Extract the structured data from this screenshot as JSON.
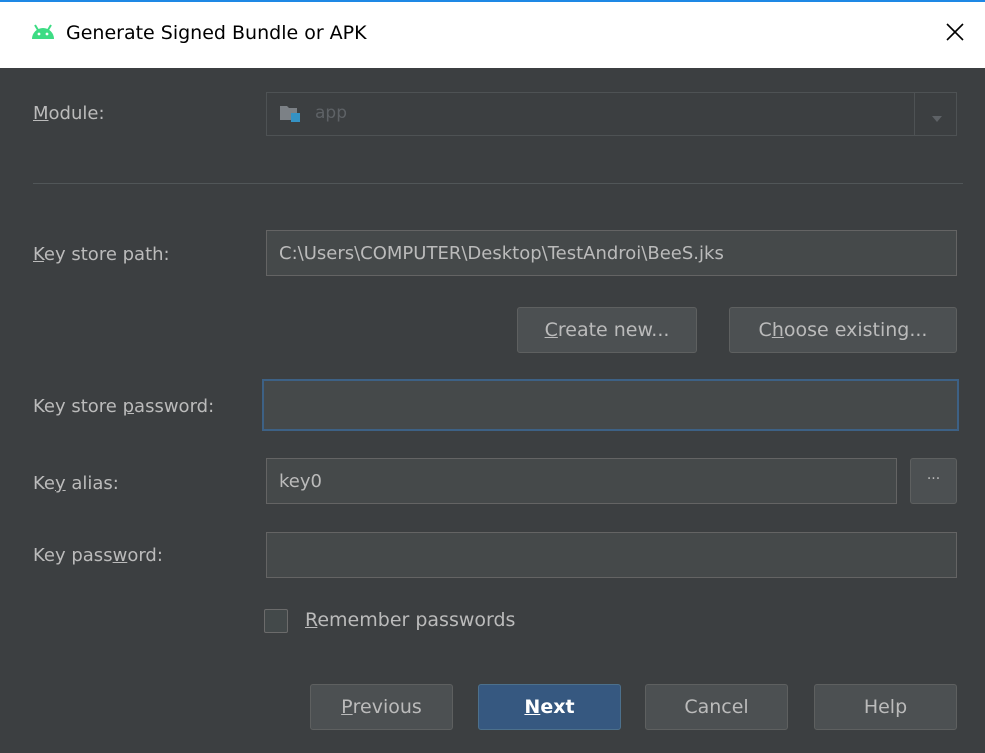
{
  "window": {
    "title": "Generate Signed Bundle or APK"
  },
  "module": {
    "label_mnemonic": "M",
    "label_rest": "odule:",
    "value": "app"
  },
  "keystore_path": {
    "label_mnemonic": "K",
    "label_rest": "ey store path:",
    "value": "C:\\Users\\COMPUTER\\Desktop\\TestAndroi\\BeeS.jks"
  },
  "buttons": {
    "create_new": {
      "mnemonic": "C",
      "rest": "reate new..."
    },
    "choose_existing": {
      "pre": "C",
      "mnemonic": "h",
      "rest": "oose existing..."
    },
    "alias_browse": "...",
    "previous": {
      "mnemonic": "P",
      "rest": "revious"
    },
    "next": {
      "mnemonic": "N",
      "rest": "ext"
    },
    "cancel": "Cancel",
    "help": "Help"
  },
  "keystore_password": {
    "label_pre": "Key store ",
    "label_mnemonic": "p",
    "label_rest": "assword:",
    "value": ""
  },
  "key_alias": {
    "label_pre": "Ke",
    "label_mnemonic": "y",
    "label_rest": " alias:",
    "value": "key0"
  },
  "key_password": {
    "label_pre": "Key pass",
    "label_mnemonic": "w",
    "label_rest": "ord:",
    "value": ""
  },
  "remember": {
    "mnemonic": "R",
    "rest": "emember passwords",
    "checked": false
  },
  "colors": {
    "dialog_bg": "#3c3f41",
    "primary_button": "#365880",
    "focus_border": "#3d6185",
    "android_green": "#3ddc84",
    "module_icon_blue": "#3592c4"
  },
  "icons": {
    "app_icon": "android-icon",
    "close": "close-icon",
    "module": "folder-module-icon",
    "dropdown": "chevron-down-icon"
  }
}
